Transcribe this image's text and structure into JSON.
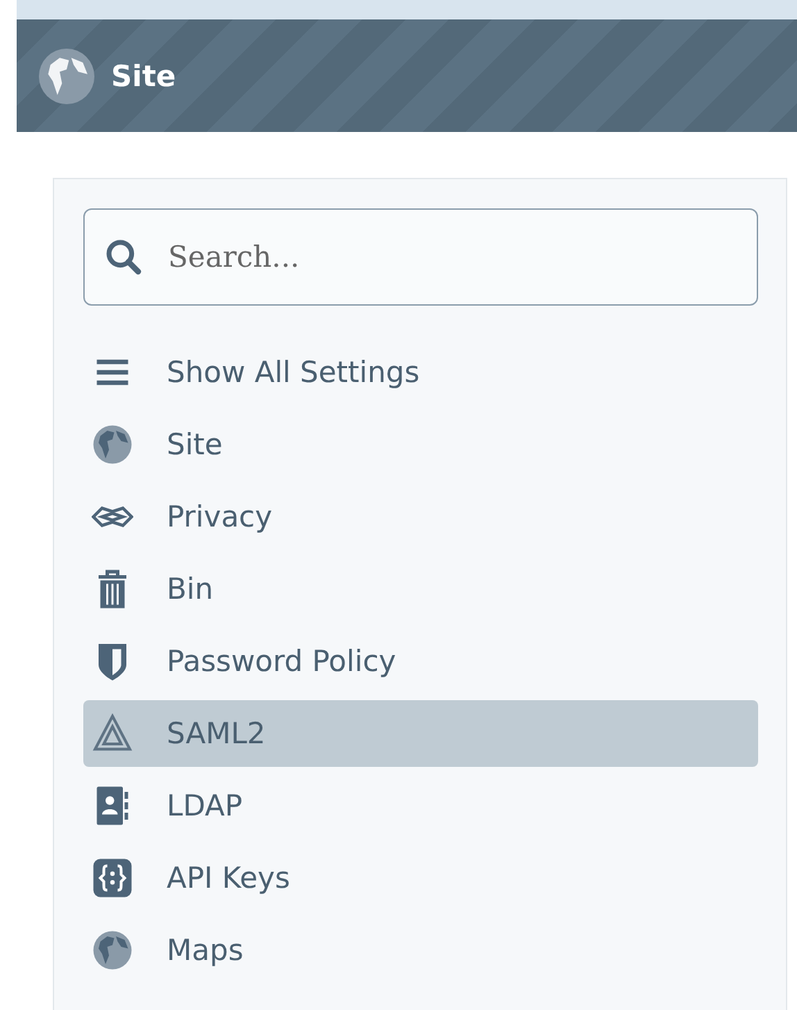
{
  "header": {
    "title": "Site"
  },
  "search": {
    "placeholder": "Search..."
  },
  "menu": [
    {
      "kind": "list",
      "label": "Show All Settings",
      "selected": false
    },
    {
      "kind": "globe",
      "label": "Site",
      "selected": false
    },
    {
      "kind": "handshake",
      "label": "Privacy",
      "selected": false
    },
    {
      "kind": "trash",
      "label": "Bin",
      "selected": false
    },
    {
      "kind": "shield",
      "label": "Password Policy",
      "selected": false
    },
    {
      "kind": "triangle",
      "label": "SAML2",
      "selected": true
    },
    {
      "kind": "contact",
      "label": "LDAP",
      "selected": false
    },
    {
      "kind": "braces",
      "label": "API Keys",
      "selected": false
    },
    {
      "kind": "globe",
      "label": "Maps",
      "selected": false
    }
  ]
}
